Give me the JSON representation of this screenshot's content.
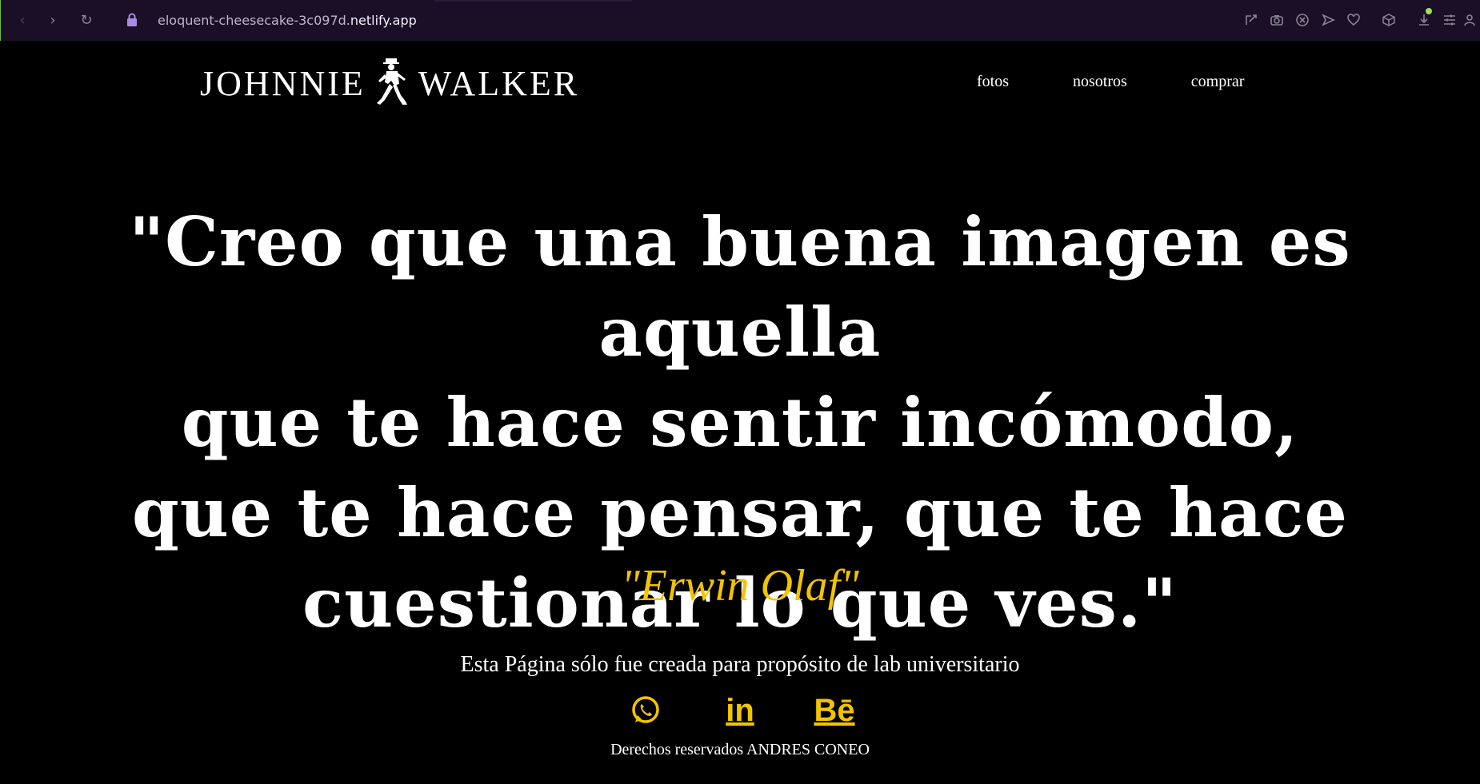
{
  "browser": {
    "url_prefix": "eloquent-cheesecake-3c097d.",
    "url_host": "netlify.app",
    "icons": [
      "share-icon",
      "camera-icon",
      "shield-icon",
      "send-icon",
      "heart-icon",
      "cube-icon",
      "download-icon",
      "sliders-icon",
      "profile-icon"
    ]
  },
  "header": {
    "logo_word1": "JOHNNIE",
    "logo_word2": "WALKER",
    "nav": [
      {
        "label": "fotos"
      },
      {
        "label": "nosotros"
      },
      {
        "label": "comprar"
      }
    ]
  },
  "hero": {
    "quote_lines": [
      "\"Creo que una buena imagen es aquella",
      "que te hace sentir incómodo,",
      "que te hace pensar, que te hace",
      "cuestionar lo que ves.\""
    ],
    "author": "\"Erwin Olaf\""
  },
  "footer": {
    "note": "Esta Página sólo fue creada para propósito de lab universitario",
    "socials": [
      {
        "name": "whatsapp-icon"
      },
      {
        "name": "linkedin-icon",
        "glyph": "in"
      },
      {
        "name": "behance-icon",
        "glyph": "Bē"
      }
    ],
    "copyright": "Derechos reservados ANDRES CONEO"
  },
  "colors": {
    "accent": "#f2c400",
    "chrome_bg": "#1a0f26",
    "page_bg": "#000000"
  }
}
